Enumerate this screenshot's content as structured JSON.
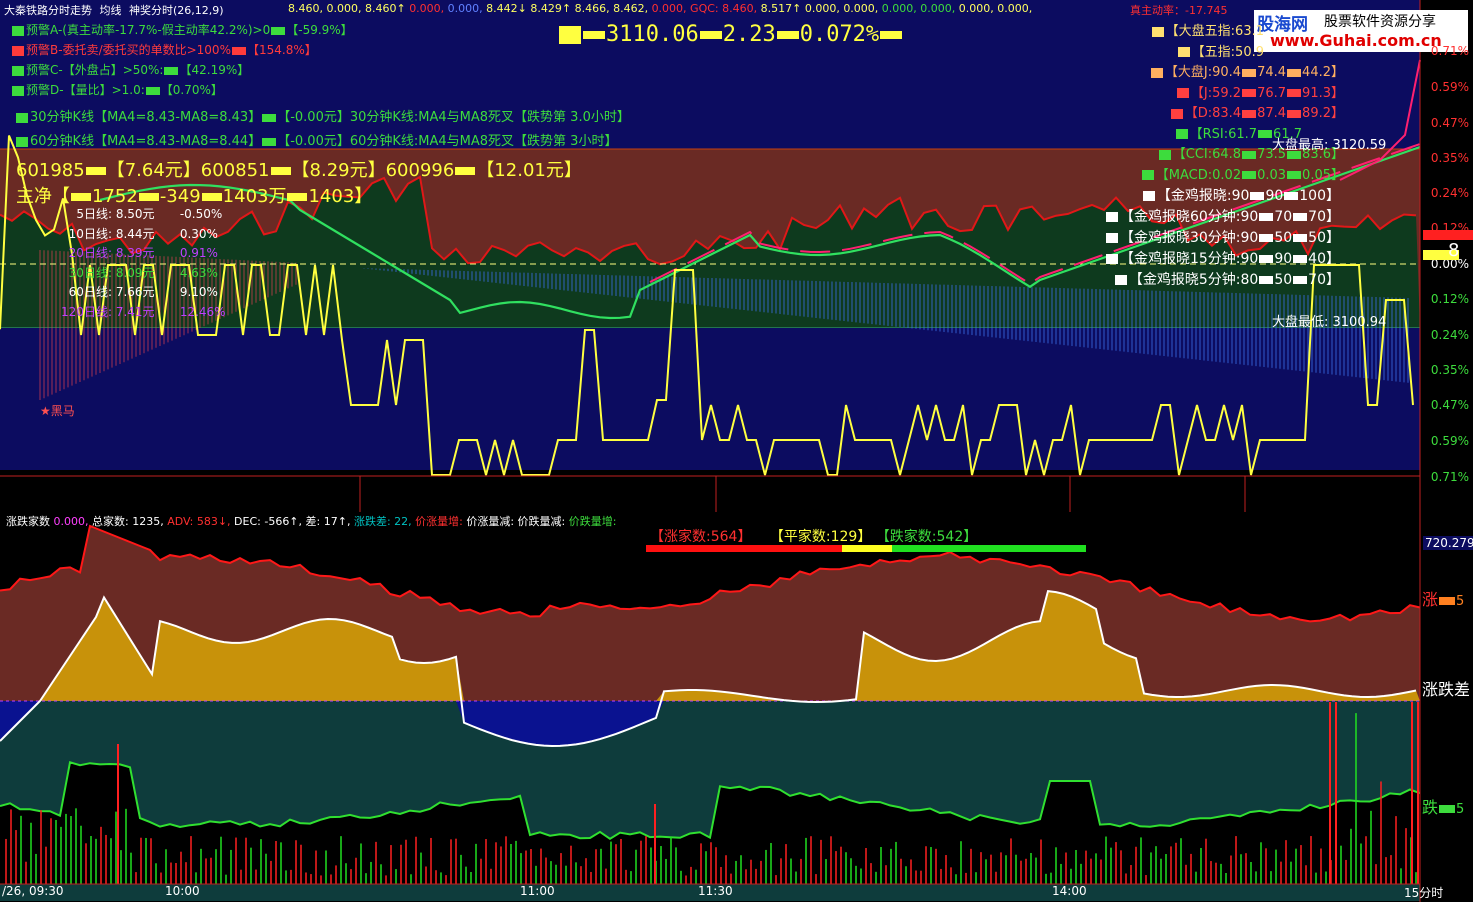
{
  "header": {
    "title": "大秦铁路分时走势",
    "mode": "均线",
    "indicator": "神奖分时(26,12,9)",
    "readouts": [
      "8.460,",
      "0.000,",
      "8.460↑",
      "0.000,",
      "0.000,",
      "8.442↓",
      "8.429↑",
      "8.466,",
      "8.462,",
      "0.000,",
      "GQC:",
      "8.460,",
      "8.517↑",
      "0.000,",
      "0.000,",
      "0.000,",
      "0.000,",
      "0.000,",
      "0.000,"
    ],
    "tail": "真主动率：-17.745"
  },
  "logo": {
    "name": "股海网",
    "slogan": "股票软件资源分享",
    "url": "www.Guhai.com.cn"
  },
  "alerts": [
    {
      "text": "预警A-(真主动率-17.7%-假主动率42.2%)>0",
      "value": "【-59.9%】",
      "color": "#3ddc3d"
    },
    {
      "text": "预警B-委托卖/委托买的单数比>100%",
      "value": "【154.8%】",
      "color": "#ff3b3b"
    },
    {
      "text": "预警C-【外盘占】>50%:",
      "value": "【42.19%】",
      "color": "#3ddc3d"
    },
    {
      "text": "预警D-【量比】>1.0:",
      "value": "【0.70%】",
      "color": "#3ddc3d"
    }
  ],
  "kline": [
    "30分钟K线【MA4=8.43-MA8=8.43】",
    "【-0.00元】30分钟K线:MA4与MA8死叉【跌势第 3.0小时】",
    "60分钟K线【MA4=8.43-MA8=8.44】",
    "【-0.00元】60分钟K线:MA4与MA8死叉【跌势第 3小时】"
  ],
  "index_quote": {
    "value": "3110.06",
    "change": "2.23",
    "pct": "0.072%"
  },
  "stocks": {
    "line": [
      "601985",
      "【7.64元】600851",
      "【8.29元】600996",
      "【12.01元】"
    ]
  },
  "main_net": {
    "label": "主净【",
    "v1": "1752",
    "v2": "-349",
    "v3": "1403万",
    "v4": "1403】"
  },
  "ma_lines": [
    {
      "label": "5日线:",
      "price": "8.50元",
      "pct": "-0.50%",
      "color": "#ffffff"
    },
    {
      "label": "10日线:",
      "price": "8.44元",
      "pct": "0.30%",
      "color": "#ffffff"
    },
    {
      "label": "20日线:",
      "price": "8.39元",
      "pct": "0.91%",
      "color": "#c040ff"
    },
    {
      "label": "30日线:",
      "price": "8.09元",
      "pct": "4.63%",
      "color": "#3ddc3d"
    },
    {
      "label": "60日线:",
      "price": "7.66元",
      "pct": "9.10%",
      "color": "#ffffff"
    },
    {
      "label": "120日线:",
      "price": "7.41元",
      "pct": "12.46%",
      "color": "#c040ff"
    }
  ],
  "right_panel": [
    {
      "text": "【大盘五指:63.1",
      "color": "#ffe070"
    },
    {
      "text": "【五指:50.9",
      "color": "#ffe070"
    },
    {
      "text": "【大盘J:90.4",
      "v2": "74.4",
      "v3": "44.2】",
      "color": "#ffb060"
    },
    {
      "text": "【J:59.2",
      "v2": "76.7",
      "v3": "91.3】",
      "color": "#ff4040"
    },
    {
      "text": "【D:83.4",
      "v2": "87.4",
      "v3": "89.2】",
      "color": "#ff4040"
    },
    {
      "text": "【RSI:61.7",
      "v2": "61.7",
      "v3": "",
      "color": "#3ddc3d"
    },
    {
      "text": "【CCI:64.8",
      "v2": "73.5",
      "v3": "83.6】",
      "color": "#3ddc3d"
    },
    {
      "text": "【MACD:0.02",
      "v2": "0.03",
      "v3": "0.05】",
      "color": "#3ddc3d"
    }
  ],
  "golden": [
    {
      "text": "【金鸡报晓:90",
      "v2": "90",
      "v3": "100】"
    },
    {
      "text": "【金鸡报晓60分钟:90",
      "v2": "70",
      "v3": "70】"
    },
    {
      "text": "【金鸡报晓30分钟:90",
      "v2": "50",
      "v3": "50】"
    },
    {
      "text": "【金鸡报晓15分钟:90",
      "v2": "90",
      "v3": "40】"
    },
    {
      "text": "【金鸡报晓5分钟:80",
      "v2": "50",
      "v3": "70】"
    }
  ],
  "market_high": "大盘最高: 3120.59",
  "market_low": "大盘最低: 3100.94",
  "right_axis_top": [
    "0.71%",
    "0.59%",
    "0.47%",
    "0.35%",
    "0.24%",
    "0.12%",
    "0.00%",
    "0.12%",
    "0.24%",
    "0.35%",
    "0.47%",
    "0.59%",
    "0.71%"
  ],
  "right_axis_price": "8",
  "star_label": "★黑马",
  "bottom_header": {
    "title": "涨跌家数",
    "items": [
      {
        "text": "0.000,",
        "color": "#ff40ff"
      },
      {
        "text": "总家数: 1235,",
        "color": "#ffffff"
      },
      {
        "text": "ADV: 583↓,",
        "color": "#ff3030"
      },
      {
        "text": "DEC: -566↑,",
        "color": "#ffffff"
      },
      {
        "text": "差: 17↑,",
        "color": "#ffffff"
      },
      {
        "text": "涨跌差: 22,",
        "color": "#00c0c0"
      },
      {
        "text": "价涨量增:",
        "color": "#ff3030"
      },
      {
        "text": "价涨量减:",
        "color": "#ffffff"
      },
      {
        "text": "价跌量减:",
        "color": "#ffffff"
      },
      {
        "text": "价跌量增:",
        "color": "#3ddc3d"
      }
    ]
  },
  "breadth": {
    "up": "【涨家数:564】",
    "flat": "【平家数:129】",
    "down": "【跌家数:542】"
  },
  "bottom_axis": {
    "top_value": "720.279",
    "up": "涨",
    "up_num": "5",
    "diff": "涨跌差",
    "down": "跌",
    "down_num": "5"
  },
  "time_axis": [
    "/26, 09:30",
    "10:00",
    "11:00",
    "11:30",
    "14:00",
    "15分时"
  ],
  "colors": {
    "price_panel_bg": "#0c0c60",
    "brown": "#6a2a24",
    "green_fill": "#0e3a1e",
    "gold": "#c8920a",
    "teal": "#0e3c3c",
    "yellow": "#ffff40"
  }
}
